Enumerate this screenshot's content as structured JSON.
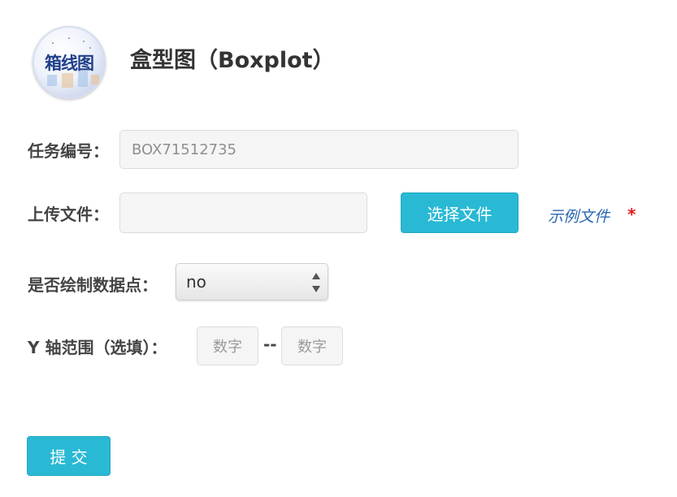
{
  "header": {
    "logo_text": "箱线图",
    "title": "盒型图（Boxplot）"
  },
  "form": {
    "task_id": {
      "label": "任务编号：",
      "value": "BOX71512735"
    },
    "upload": {
      "label": "上传文件：",
      "value": "",
      "choose_button": "选择文件",
      "example_link": "示例文件",
      "required_mark": "*"
    },
    "draw_points": {
      "label": "是否绘制数据点：",
      "selected": "no"
    },
    "y_range": {
      "label": "Y 轴范围（选填）：",
      "min_placeholder": "数字",
      "separator": "--",
      "max_placeholder": "数字"
    },
    "submit_label": "提 交"
  },
  "colors": {
    "accent": "#29b9d4",
    "link": "#2a66b0",
    "required": "#e0191f",
    "logo_text": "#1f3f8a"
  }
}
